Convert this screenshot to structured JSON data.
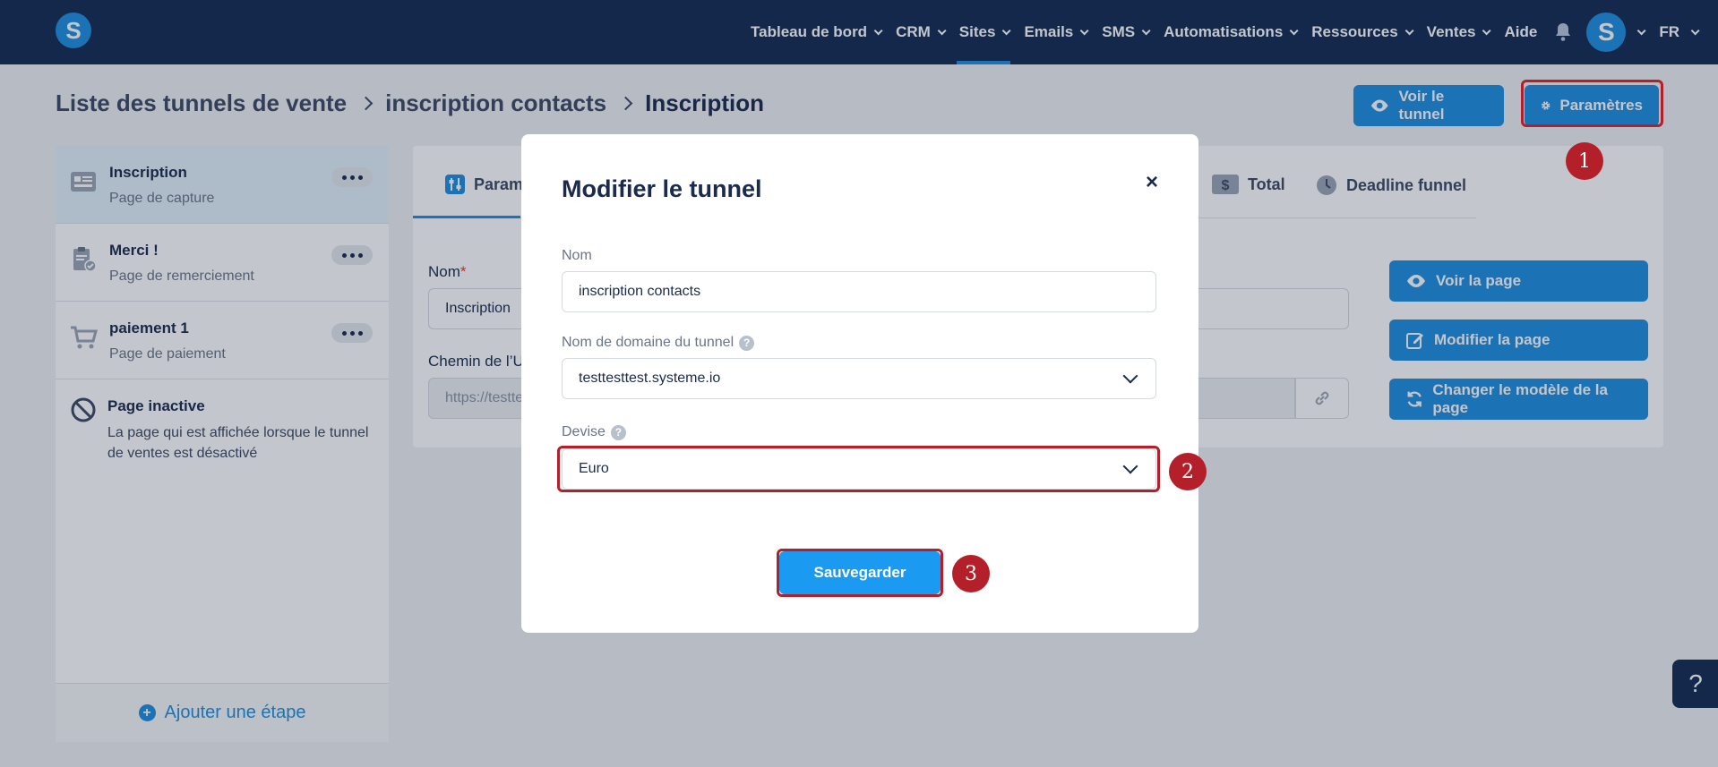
{
  "nav": {
    "logo": "S",
    "items": [
      {
        "label": "Tableau de bord",
        "chevron": true
      },
      {
        "label": "CRM",
        "chevron": true
      },
      {
        "label": "Sites",
        "chevron": true,
        "active": true
      },
      {
        "label": "Emails",
        "chevron": true
      },
      {
        "label": "SMS",
        "chevron": true
      },
      {
        "label": "Automatisations",
        "chevron": true
      },
      {
        "label": "Ressources",
        "chevron": true
      },
      {
        "label": "Ventes",
        "chevron": true
      },
      {
        "label": "Aide",
        "chevron": false
      }
    ],
    "avatar": "S",
    "language": "FR"
  },
  "breadcrumb": {
    "items": [
      "Liste des tunnels de vente",
      "inscription contacts",
      "Inscription"
    ]
  },
  "header_buttons": {
    "view_funnel": "Voir le tunnel",
    "settings": "Paramètres"
  },
  "sidebar": {
    "steps": [
      {
        "title": "Inscription",
        "subtitle": "Page de capture",
        "icon": "capture-page-icon",
        "selected": true
      },
      {
        "title": "Merci !",
        "subtitle": "Page de remerciement",
        "icon": "thank-you-page-icon",
        "selected": false
      },
      {
        "title": "paiement 1",
        "subtitle": "Page de paiement",
        "icon": "cart-icon",
        "selected": false
      }
    ],
    "inactive": {
      "title": "Page inactive",
      "description": "La page qui est affichée lorsque le tunnel de ventes est désactivé"
    },
    "add_step": "Ajouter une étape"
  },
  "panel": {
    "tabs": [
      {
        "label": "Paramètres",
        "icon": "sliders-icon"
      },
      {
        "label": "Total",
        "icon": "dollar-icon"
      },
      {
        "label": "Deadline funnel",
        "icon": "clock-icon"
      }
    ],
    "name_label": "Nom",
    "name_value": "Inscription",
    "path_label": "Chemin de l’URL",
    "path_value": "https://testtesttest.systeme.io/",
    "buttons": {
      "view_page": "Voir la page",
      "edit_page": "Modifier la page",
      "change_template": "Changer le modèle de la page"
    }
  },
  "modal": {
    "title": "Modifier le tunnel",
    "close": "×",
    "name_label": "Nom",
    "name_value": "inscription contacts",
    "domain_label": "Nom de domaine du tunnel",
    "domain_value": "testtesttest.systeme.io",
    "currency_label": "Devise",
    "currency_value": "Euro",
    "save": "Sauvegarder"
  },
  "annotations": {
    "badge1": "1",
    "badge2": "2",
    "badge3": "3",
    "highlight_color": "#b3202a"
  },
  "help_button": "?"
}
